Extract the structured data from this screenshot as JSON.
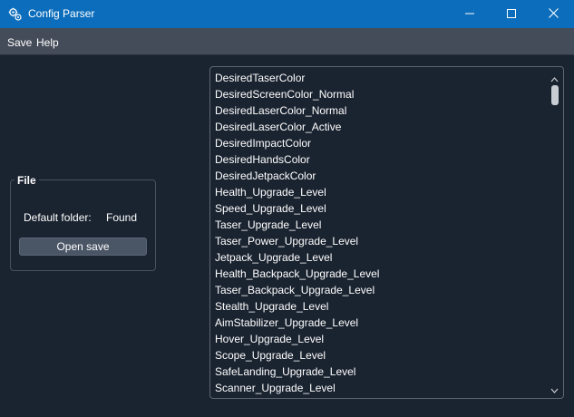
{
  "window": {
    "title": "Config Parser",
    "icon": "gears-icon",
    "controls": [
      "minimize-icon",
      "maximize-icon",
      "close-icon"
    ]
  },
  "menu": {
    "save": "Save",
    "help": "Help"
  },
  "file_group": {
    "title": "File",
    "default_folder_label": "Default folder:",
    "default_folder_status": "Found",
    "open_save_button": "Open save"
  },
  "list": {
    "items": [
      "DesiredTaserColor",
      "DesiredScreenColor_Normal",
      "DesiredLaserColor_Normal",
      "DesiredLaserColor_Active",
      "DesiredImpactColor",
      "DesiredHandsColor",
      "DesiredJetpackColor",
      "Health_Upgrade_Level",
      "Speed_Upgrade_Level",
      "Taser_Upgrade_Level",
      "Taser_Power_Upgrade_Level",
      "Jetpack_Upgrade_Level",
      "Health_Backpack_Upgrade_Level",
      "Taser_Backpack_Upgrade_Level",
      "Stealth_Upgrade_Level",
      "AimStabilizer_Upgrade_Level",
      "Hover_Upgrade_Level",
      "Scope_Upgrade_Level",
      "SafeLanding_Upgrade_Level",
      "Scanner_Upgrade_Level"
    ]
  },
  "colors": {
    "titlebar": "#0b6dbb",
    "menubar": "#454c59",
    "background": "#1a2330",
    "button": "#4a5565",
    "text": "#ffffff"
  }
}
